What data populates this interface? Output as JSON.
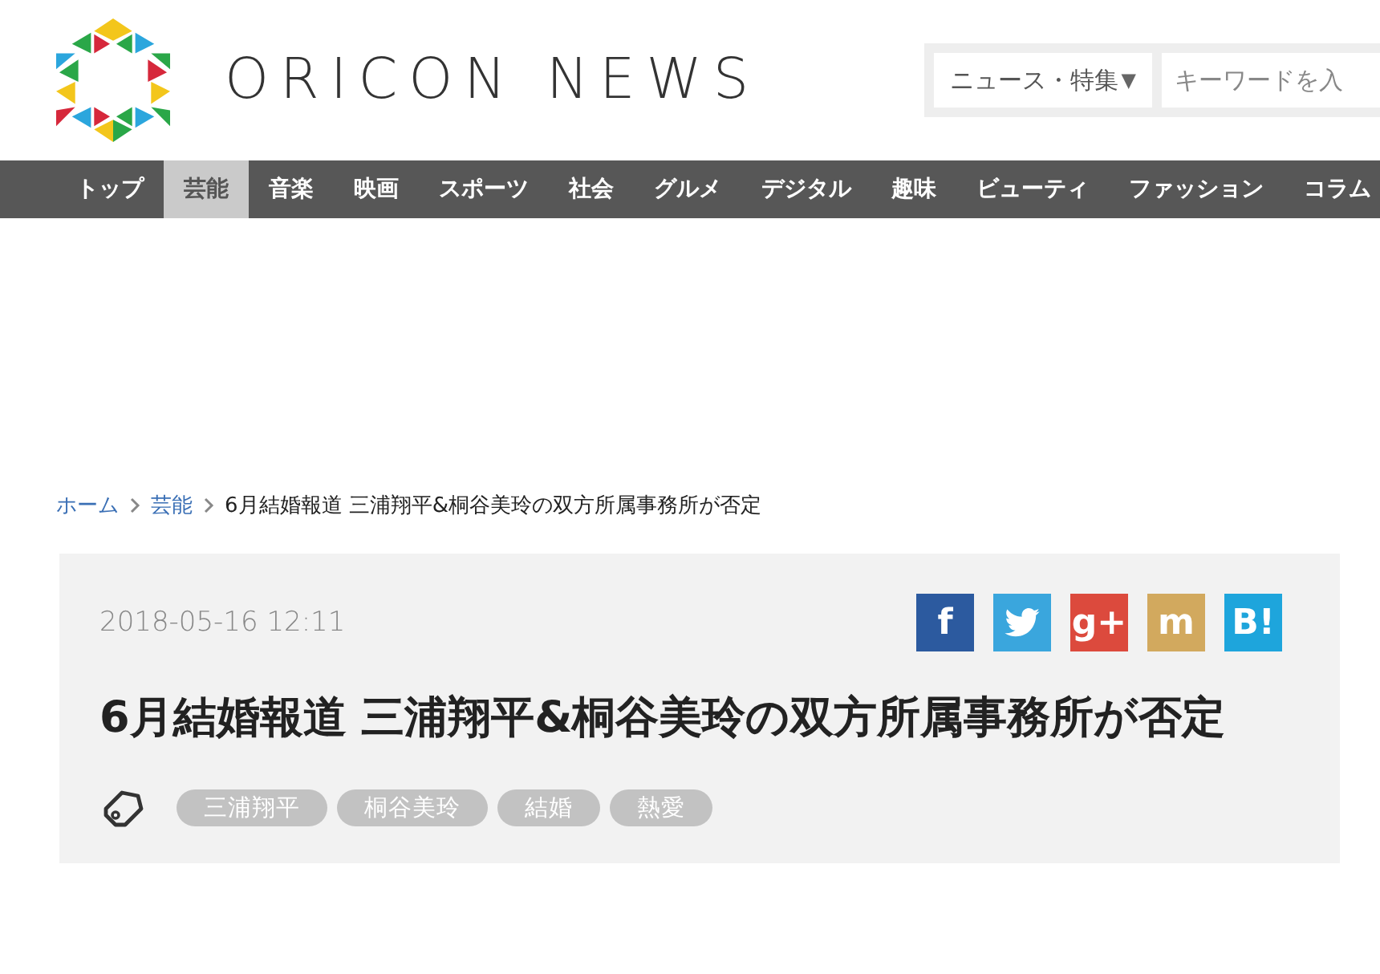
{
  "header": {
    "logo_text": "ORICON NEWS",
    "search": {
      "category": "ニュース・特集",
      "caret": "▼",
      "placeholder": "キーワードを入"
    }
  },
  "nav": [
    {
      "label": "トップ",
      "selected": false
    },
    {
      "label": "芸能",
      "selected": true
    },
    {
      "label": "音楽",
      "selected": false
    },
    {
      "label": "映画",
      "selected": false
    },
    {
      "label": "スポーツ",
      "selected": false
    },
    {
      "label": "社会",
      "selected": false
    },
    {
      "label": "グルメ",
      "selected": false
    },
    {
      "label": "デジタル",
      "selected": false
    },
    {
      "label": "趣味",
      "selected": false
    },
    {
      "label": "ビューティ",
      "selected": false
    },
    {
      "label": "ファッション",
      "selected": false
    },
    {
      "label": "コラム",
      "selected": false
    }
  ],
  "breadcrumb": [
    {
      "label": "ホーム",
      "kind": "link"
    },
    {
      "label": "芸能",
      "kind": "link"
    },
    {
      "label": "6月結婚報道 三浦翔平&桐谷美玲の双方所属事務所が否定",
      "kind": "current"
    }
  ],
  "article": {
    "date": "2018-05-16  12:11",
    "share": [
      {
        "kind": "glyph",
        "label": "f",
        "color": "#2c5a9f"
      },
      {
        "kind": "bird",
        "color": "#3aa6dd"
      },
      {
        "kind": "glyph",
        "label": "g+",
        "color": "#dc4a3d"
      },
      {
        "kind": "glyph",
        "label": "m",
        "color": "#d2a95e"
      },
      {
        "kind": "glyph",
        "label": "B!",
        "color": "#1ea5dc"
      }
    ],
    "title": "6月結婚報道 三浦翔平&桐谷美玲の双方所属事務所が否定",
    "tags": [
      "三浦翔平",
      "桐谷美玲",
      "結婚",
      "熱愛"
    ]
  }
}
